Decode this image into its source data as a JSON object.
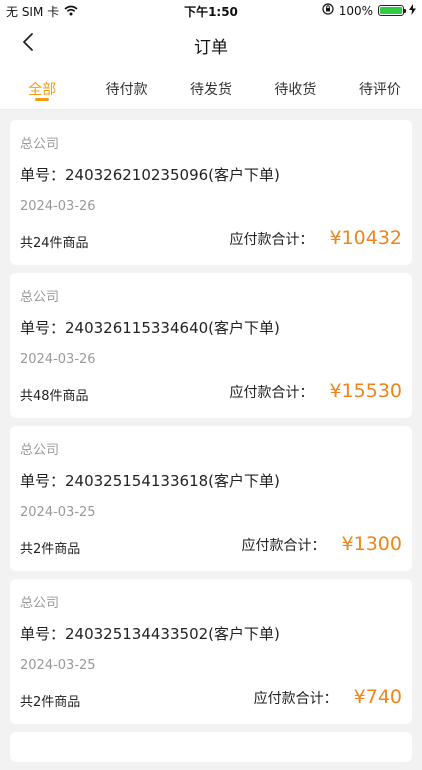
{
  "status_bar": {
    "carrier": "无 SIM 卡",
    "time": "下午1:50",
    "battery_percent": "100%",
    "battery_level": 1.0,
    "wifi_icon": "wifi-icon",
    "rotation_lock_icon": "rotation-lock-icon",
    "charging_icon": "charging-icon"
  },
  "nav": {
    "title": "订单",
    "back_icon": "chevron-left-icon"
  },
  "tabs": [
    {
      "label": "全部",
      "active": true
    },
    {
      "label": "待付款",
      "active": false
    },
    {
      "label": "待发货",
      "active": false
    },
    {
      "label": "待收货",
      "active": false
    },
    {
      "label": "待评价",
      "active": false
    }
  ],
  "orders": [
    {
      "company": "总公司",
      "order_no": "单号：240326210235096(客户下单)",
      "date": "2024-03-26",
      "count": "共24件商品",
      "amount_label": "应付款合计：",
      "amount": "¥10432"
    },
    {
      "company": "总公司",
      "order_no": "单号：240326115334640(客户下单)",
      "date": "2024-03-26",
      "count": "共48件商品",
      "amount_label": "应付款合计：",
      "amount": "¥15530"
    },
    {
      "company": "总公司",
      "order_no": "单号：240325154133618(客户下单)",
      "date": "2024-03-25",
      "count": "共2件商品",
      "amount_label": "应付款合计：",
      "amount": "¥1300"
    },
    {
      "company": "总公司",
      "order_no": "单号：240325134433502(客户下单)",
      "date": "2024-03-25",
      "count": "共2件商品",
      "amount_label": "应付款合计：",
      "amount": "¥740"
    }
  ],
  "colors": {
    "accent": "#f39c12",
    "amount": "#f08519",
    "background": "#f2f2f2"
  }
}
